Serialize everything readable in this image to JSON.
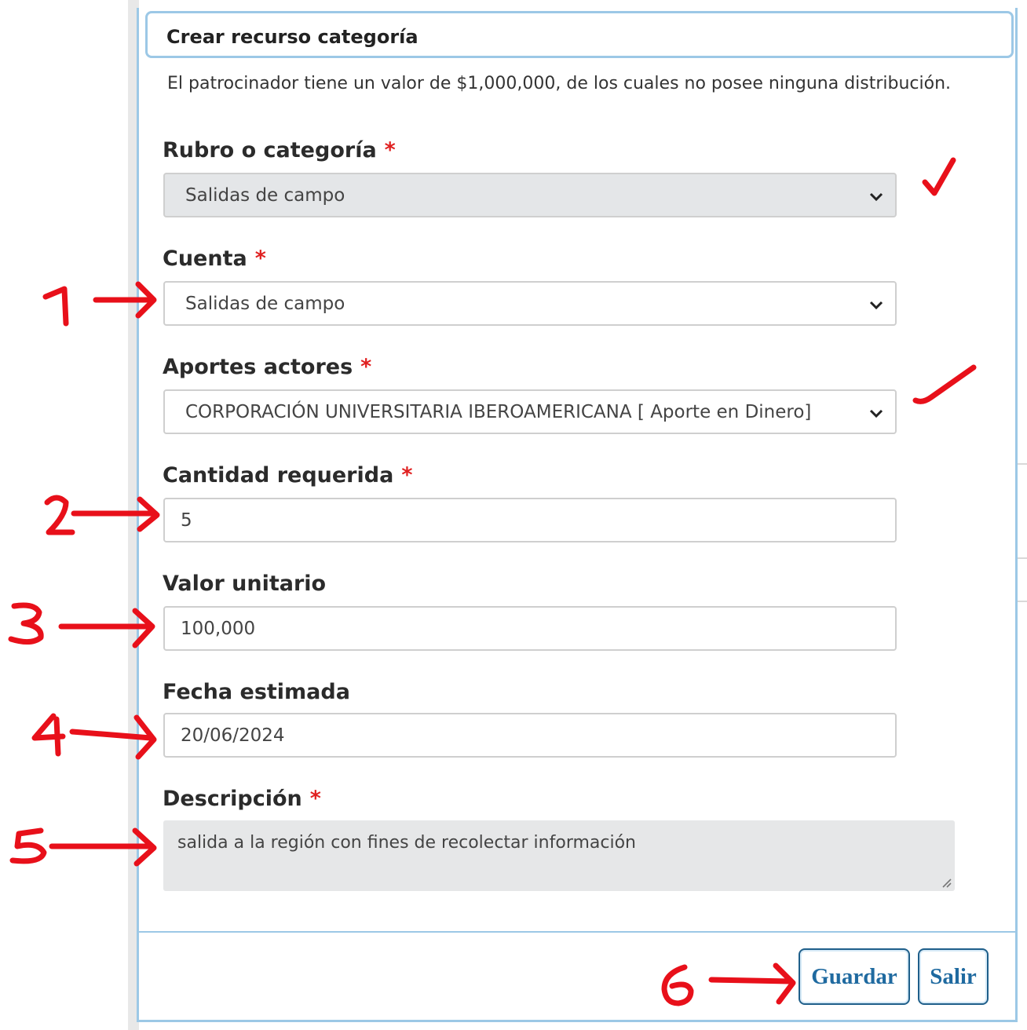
{
  "dialog": {
    "title": "Crear recurso categoría",
    "intro": "El patrocinador tiene un valor de $1,000,000, de los cuales no posee ninguna distribución."
  },
  "fields": {
    "rubro": {
      "label": "Rubro o categoría",
      "required": "*",
      "value": "Salidas de campo"
    },
    "cuenta": {
      "label": "Cuenta",
      "required": "*",
      "value": "Salidas de campo"
    },
    "aportes": {
      "label": "Aportes actores",
      "required": "*",
      "value": "CORPORACIÓN UNIVERSITARIA IBEROAMERICANA [ Aporte en Dinero]"
    },
    "cantidad": {
      "label": "Cantidad requerida",
      "required": "*",
      "value": "5"
    },
    "valor": {
      "label": "Valor unitario",
      "value": "100,000"
    },
    "fecha": {
      "label": "Fecha estimada",
      "value": "20/06/2024"
    },
    "descripcion": {
      "label": "Descripción",
      "required": "*",
      "value": "salida a la región con fines de recolectar información"
    }
  },
  "buttons": {
    "save": "Guardar",
    "exit": "Salir"
  },
  "annotations": {
    "numbers": [
      "1",
      "2",
      "3",
      "4",
      "5",
      "6"
    ],
    "color": "#e8101a"
  },
  "colors": {
    "modal_border": "#9cc8e6",
    "required": "#e02020",
    "button_text": "#1f6aa0"
  },
  "icons": [
    "chevron-down-icon",
    "resize-grip-icon",
    "checkmark-icon",
    "arrow-icon"
  ]
}
